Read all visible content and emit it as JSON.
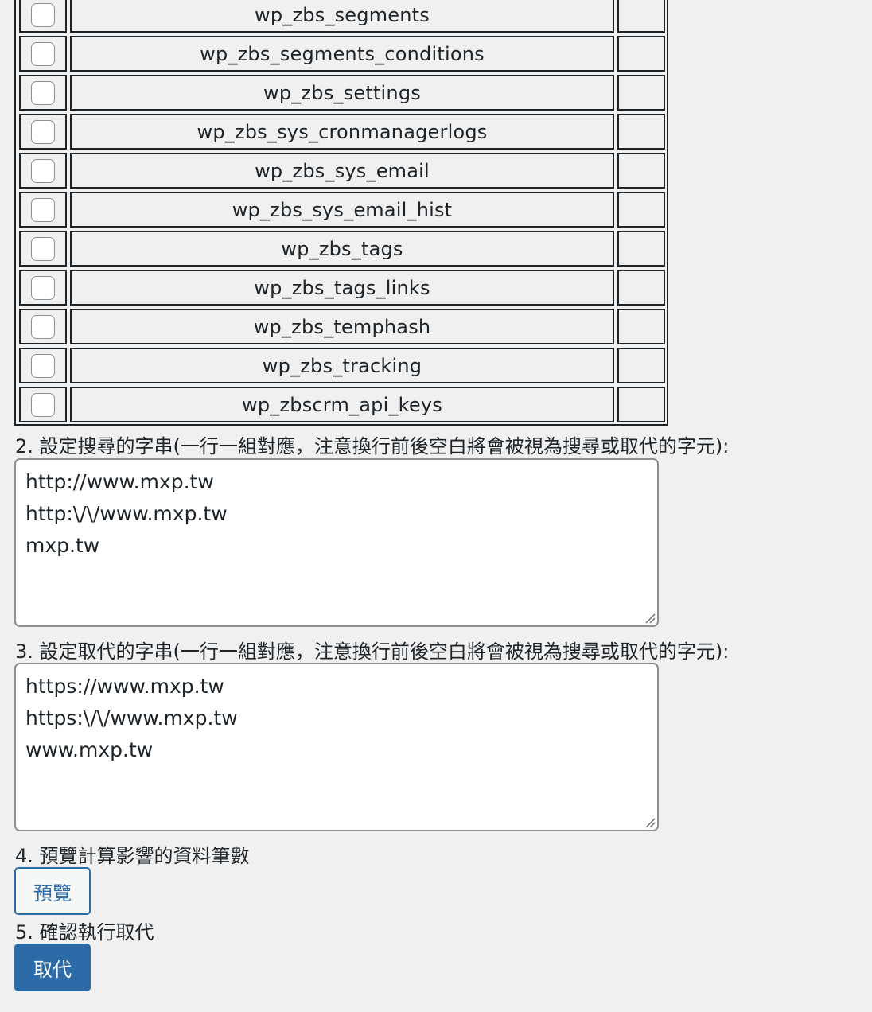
{
  "tables": [
    "wp_zbs_segments",
    "wp_zbs_segments_conditions",
    "wp_zbs_settings",
    "wp_zbs_sys_cronmanagerlogs",
    "wp_zbs_sys_email",
    "wp_zbs_sys_email_hist",
    "wp_zbs_tags",
    "wp_zbs_tags_links",
    "wp_zbs_temphash",
    "wp_zbs_tracking",
    "wp_zbscrm_api_keys"
  ],
  "search": {
    "label": "2. 設定搜尋的字串(一行一組對應，注意換行前後空白將會被視為搜尋或取代的字元):",
    "lines": [
      "http://www.mxp.tw",
      "http:\\/\\/www.mxp.tw",
      "mxp.tw"
    ]
  },
  "replace": {
    "label": "3. 設定取代的字串(一行一組對應，注意換行前後空白將會被視為搜尋或取代的字元):",
    "lines": [
      "https://www.mxp.tw",
      "https:\\/\\/www.mxp.tw",
      "www.mxp.tw"
    ]
  },
  "preview": {
    "label": "4. 預覽計算影響的資料筆數",
    "button": "預覽"
  },
  "confirm": {
    "label": "5. 確認執行取代",
    "button": "取代"
  },
  "colors": {
    "accent": "#2c6ba8",
    "background": "#f0f0f1",
    "border": "#1d2327"
  }
}
